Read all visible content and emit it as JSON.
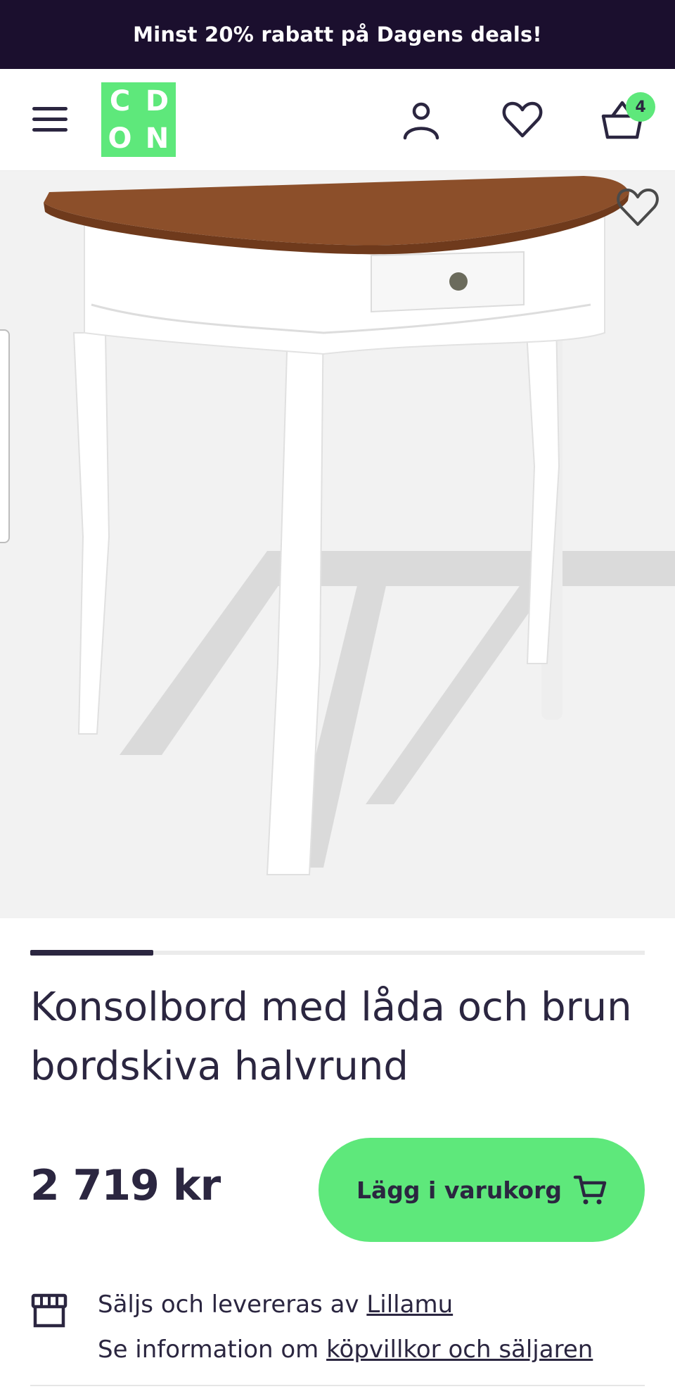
{
  "promo": {
    "text": "Minst 20% rabatt på Dagens deals!"
  },
  "header": {
    "logo_letters": [
      "C",
      "D",
      "O",
      "N"
    ],
    "cart_count": "4",
    "icons": [
      "menu-icon",
      "user-icon",
      "heart-icon",
      "basket-icon"
    ]
  },
  "gallery": {
    "image_subject": "white half-round console table with brown top and drawer",
    "carousel_position": 1
  },
  "product": {
    "title": "Konsolbord med låda och brun bordskiva halvrund",
    "price": "2 719 kr",
    "add_to_cart_label": "Lägg i varukorg"
  },
  "seller": {
    "line1_prefix": "Säljs och levereras av ",
    "seller_name": "Lillamu",
    "line2_prefix": "Se information om ",
    "terms_link": "köpvillkor och säljaren"
  },
  "colors": {
    "promo_bg": "#1b0f2e",
    "brand_green": "#5ee87b",
    "text_dark": "#2b2640"
  }
}
